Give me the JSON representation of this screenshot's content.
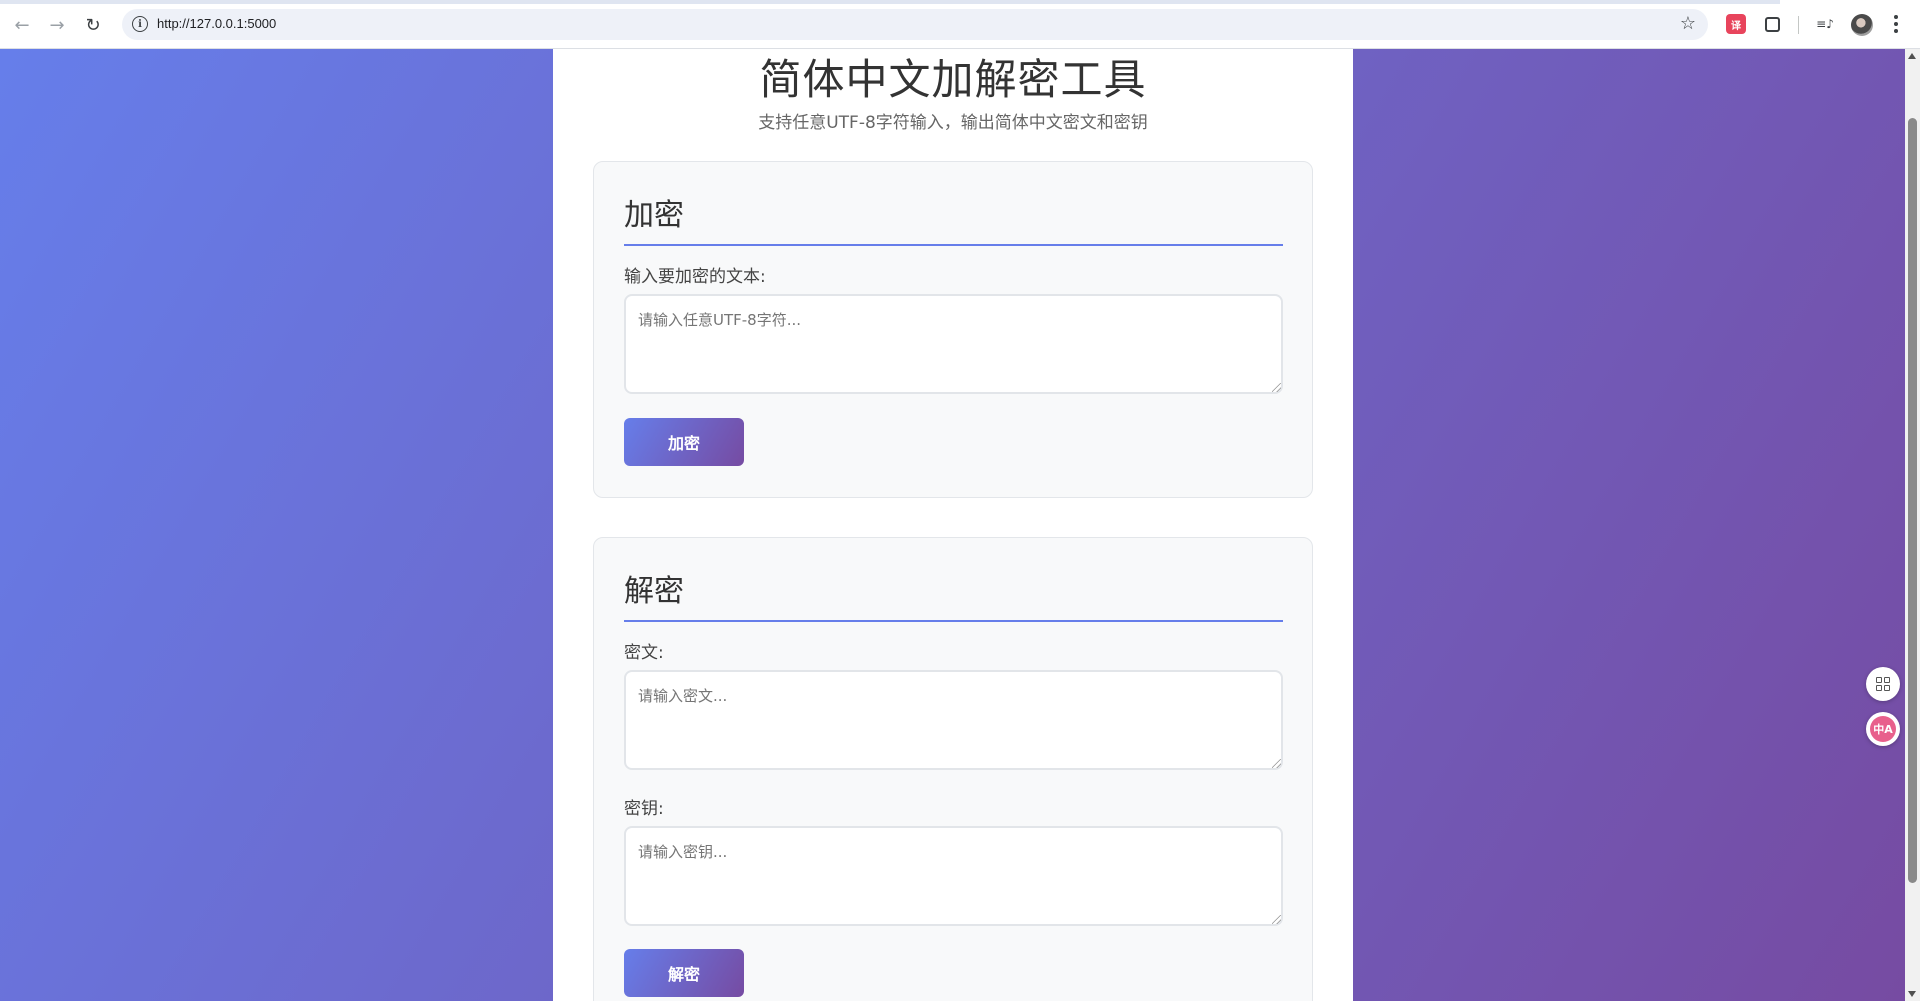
{
  "browser": {
    "url": "http://127.0.0.1:5000",
    "back_icon": "←",
    "forward_icon": "→",
    "reload_icon": "↻",
    "info_icon": "i",
    "star_icon": "☆",
    "translate_ext_label": "译",
    "media_icon": "≡♪"
  },
  "page": {
    "title": "简体中文加解密工具",
    "subtitle": "支持任意UTF-8字符输入，输出简体中文密文和密钥"
  },
  "encrypt": {
    "heading": "加密",
    "input_label": "输入要加密的文本:",
    "input_placeholder": "请输入任意UTF-8字符...",
    "button_label": "加密"
  },
  "decrypt": {
    "heading": "解密",
    "ciphertext_label": "密文:",
    "ciphertext_placeholder": "请输入密文...",
    "key_label": "密钥:",
    "key_placeholder": "请输入密钥...",
    "button_label": "解密"
  },
  "floating": {
    "translate_label": "中A"
  },
  "colors": {
    "gradient_start": "#667eea",
    "gradient_end": "#764ba2",
    "section_bg": "#f8f9fa"
  }
}
